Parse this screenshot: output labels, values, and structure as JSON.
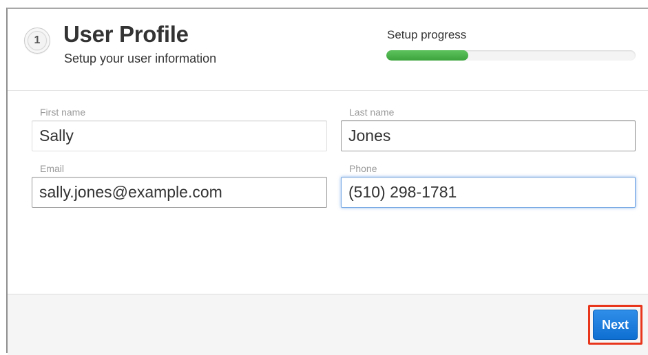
{
  "header": {
    "step_number": "1",
    "title": "User Profile",
    "subtitle": "Setup your user information"
  },
  "progress": {
    "label": "Setup progress",
    "percent": 33
  },
  "form": {
    "first_name": {
      "label": "First name",
      "value": "Sally"
    },
    "last_name": {
      "label": "Last name",
      "value": "Jones"
    },
    "email": {
      "label": "Email",
      "value": "sally.jones@example.com"
    },
    "phone": {
      "label": "Phone",
      "value": "(510) 298-1781"
    }
  },
  "footer": {
    "next_label": "Next"
  },
  "colors": {
    "progress_fill": "#4cb84c",
    "primary_button": "#1a7ddf",
    "highlight": "#e8361c",
    "focus_ring": "#74a7e4"
  }
}
